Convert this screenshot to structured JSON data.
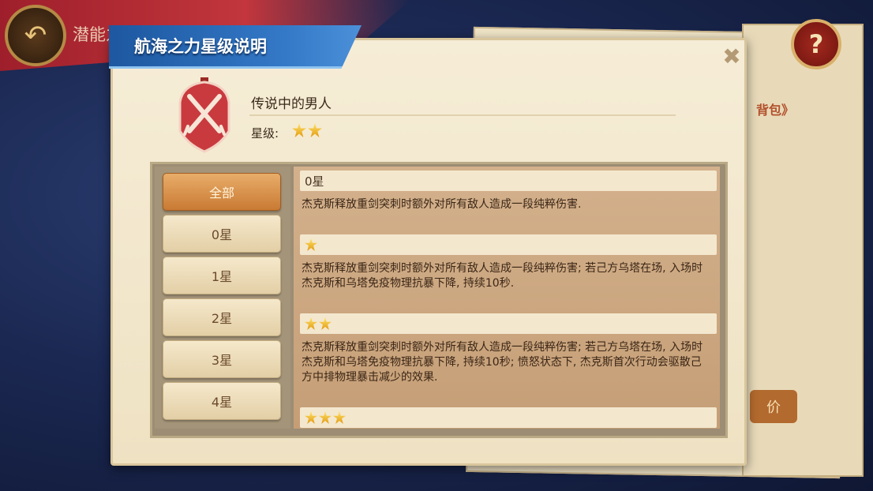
{
  "background": {
    "banner_title": "潜能之力",
    "side_link": "背包》",
    "side_button": "价"
  },
  "dialog": {
    "title": "航海之力星级说明",
    "close_label": "✖",
    "hero": {
      "name": "传说中的男人",
      "star_label": "星级:",
      "stars": 2
    },
    "tabs": [
      {
        "label": "全部",
        "active": true
      },
      {
        "label": "0星",
        "active": false
      },
      {
        "label": "1星",
        "active": false
      },
      {
        "label": "2星",
        "active": false
      },
      {
        "label": "3星",
        "active": false
      },
      {
        "label": "4星",
        "active": false
      }
    ],
    "sections": [
      {
        "header": "0星",
        "stars": 0,
        "text": "杰克斯释放重剑突刺时额外对所有敌人造成一段纯粹伤害."
      },
      {
        "header": "",
        "stars": 1,
        "text": "杰克斯释放重剑突刺时额外对所有敌人造成一段纯粹伤害; 若己方乌塔在场, 入场时杰克斯和乌塔免疫物理抗暴下降, 持续10秒."
      },
      {
        "header": "",
        "stars": 2,
        "text": "杰克斯释放重剑突刺时额外对所有敌人造成一段纯粹伤害; 若己方乌塔在场, 入场时杰克斯和乌塔免疫物理抗暴下降, 持续10秒; 愤怒状态下, 杰克斯首次行动会驱散己方中排物理暴击减少的效果."
      },
      {
        "header": "",
        "stars": 3,
        "text": ""
      }
    ]
  },
  "help_label": "?",
  "back_label": "↶",
  "colors": {
    "accent": "#c97a33",
    "ribbon": "#3479c7",
    "emblem": "#c93a3f"
  }
}
